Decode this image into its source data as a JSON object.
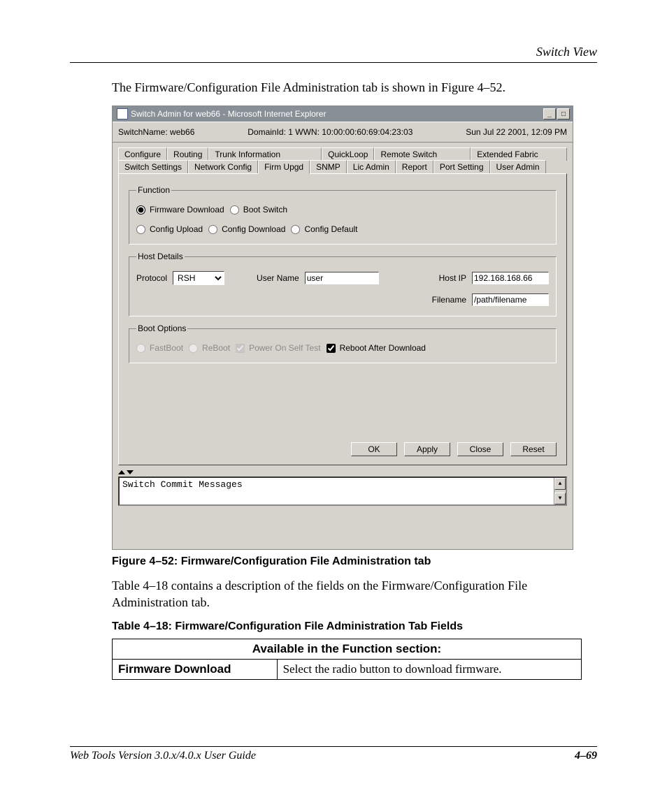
{
  "doc": {
    "section_header": "Switch View",
    "intro": "The Firmware/Configuration File Administration tab is shown in Figure 4–52.",
    "figure_caption": "Figure 4–52:  Firmware/Configuration File Administration tab",
    "post_figure": "Table 4–18 contains a description of the fields on the Firmware/Configuration File Administration tab.",
    "table_caption": "Table 4–18:  Firmware/Configuration File Administration Tab Fields",
    "table_header": "Available in the Function section:",
    "row1_key": "Firmware Download",
    "row1_val": "Select the radio button to download firmware.",
    "footer_left": "Web Tools Version 3.0.x/4.0.x User Guide",
    "footer_right": "4–69"
  },
  "shot": {
    "title": "Switch Admin for web66 - Microsoft Internet Explorer",
    "status": {
      "switchname_lbl": "SwitchName:",
      "switchname_val": "web66",
      "domain": "DomainId: 1  WWN: 10:00:00:60:69:04:23:03",
      "date": "Sun Jul 22  2001, 12:09 PM"
    },
    "tabs_top": [
      "Configure",
      "Routing",
      "Trunk Information",
      "QuickLoop",
      "Remote Switch",
      "Extended Fabric"
    ],
    "tabs_bot": [
      "Switch Settings",
      "Network Config",
      "Firm Upgd",
      "SNMP",
      "Lic Admin",
      "Report",
      "Port Setting",
      "User Admin"
    ],
    "function": {
      "legend": "Function",
      "opts1": [
        "Firmware Download",
        "Boot Switch"
      ],
      "opts2": [
        "Config Upload",
        "Config Download",
        "Config Default"
      ]
    },
    "host": {
      "legend": "Host Details",
      "protocol_lbl": "Protocol",
      "protocol_val": "RSH",
      "user_lbl": "User Name",
      "user_val": "user",
      "ip_lbl": "Host IP",
      "ip_val": "192.168.168.66",
      "file_lbl": "Filename",
      "file_val": "/path/filename"
    },
    "boot": {
      "legend": "Boot Options",
      "opts": [
        "FastBoot",
        "ReBoot",
        "Power On Self Test",
        "Reboot After Download"
      ]
    },
    "buttons": [
      "OK",
      "Apply",
      "Close",
      "Reset"
    ],
    "commit_label": "Switch Commit Messages"
  }
}
